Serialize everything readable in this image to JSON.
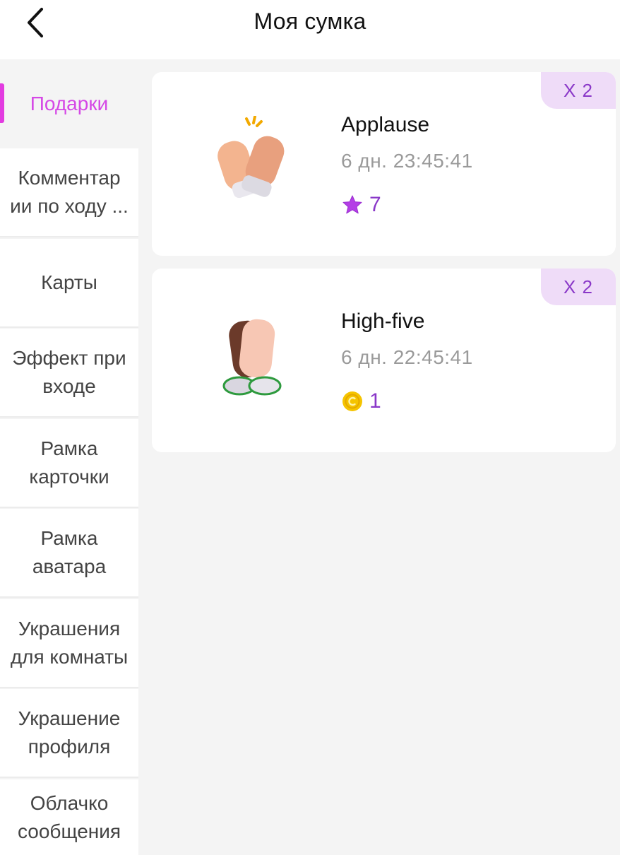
{
  "header": {
    "title": "Моя сумка",
    "back_icon": "chevron-left-icon"
  },
  "sidebar": {
    "items": [
      {
        "label": "Подарки",
        "active": true
      },
      {
        "label": "Комментар\nии по ходу ..."
      },
      {
        "label": "Карты"
      },
      {
        "label": "Эффект при\nвходе"
      },
      {
        "label": "Рамка\nкарточки"
      },
      {
        "label": "Рамка\nаватара"
      },
      {
        "label": "Украшения\nдля комнаты"
      },
      {
        "label": "Украшение\nпрофиля"
      },
      {
        "label": "Облачко\nсообщения"
      }
    ]
  },
  "gifts": [
    {
      "name": "Applause",
      "timer": "6 дн. 23:45:41",
      "price": "7",
      "currency_icon": "star-icon",
      "quantity": "X 2",
      "icon": "clapping-hands-icon"
    },
    {
      "name": "High-five",
      "timer": "6 дн. 22:45:41",
      "price": "1",
      "currency_icon": "gold-coin-icon",
      "quantity": "X 2",
      "icon": "high-five-icon"
    }
  ],
  "colors": {
    "accent": "#d548e6",
    "purple": "#8a38c8",
    "badge_bg": "#efdcf8",
    "coin": "#f5c400"
  }
}
